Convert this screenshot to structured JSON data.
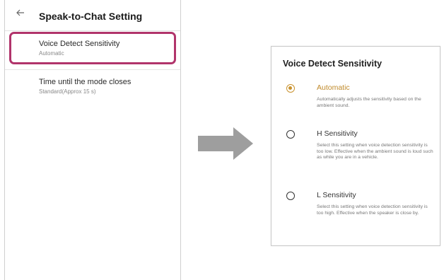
{
  "left_screen": {
    "title": "Speak-to-Chat Setting",
    "items": [
      {
        "label": "Voice Detect Sensitivity",
        "value": "Automatic",
        "highlighted": true
      },
      {
        "label": "Time until the mode closes",
        "value": "Standard(Approx 15 s)",
        "highlighted": false
      }
    ],
    "highlight_color": "#b1346b"
  },
  "dialog": {
    "title": "Voice Detect Sensitivity",
    "options": [
      {
        "label": "Automatic",
        "selected": true,
        "description": "Automatically adjusts the sensitivity based on the ambient sound."
      },
      {
        "label": "H Sensitivity",
        "selected": false,
        "description": "Select this setting when voice detection sensitivity is too low. Effective when the ambient sound is loud such as while you are in a vehicle."
      },
      {
        "label": "L Sensitivity",
        "selected": false,
        "description": "Select this setting when voice detection sensitivity is too high. Effective when the speaker is close by."
      }
    ],
    "accent_color": "#c9922e"
  },
  "icons": {
    "back": "back-arrow-icon",
    "transition": "right-arrow-icon"
  }
}
